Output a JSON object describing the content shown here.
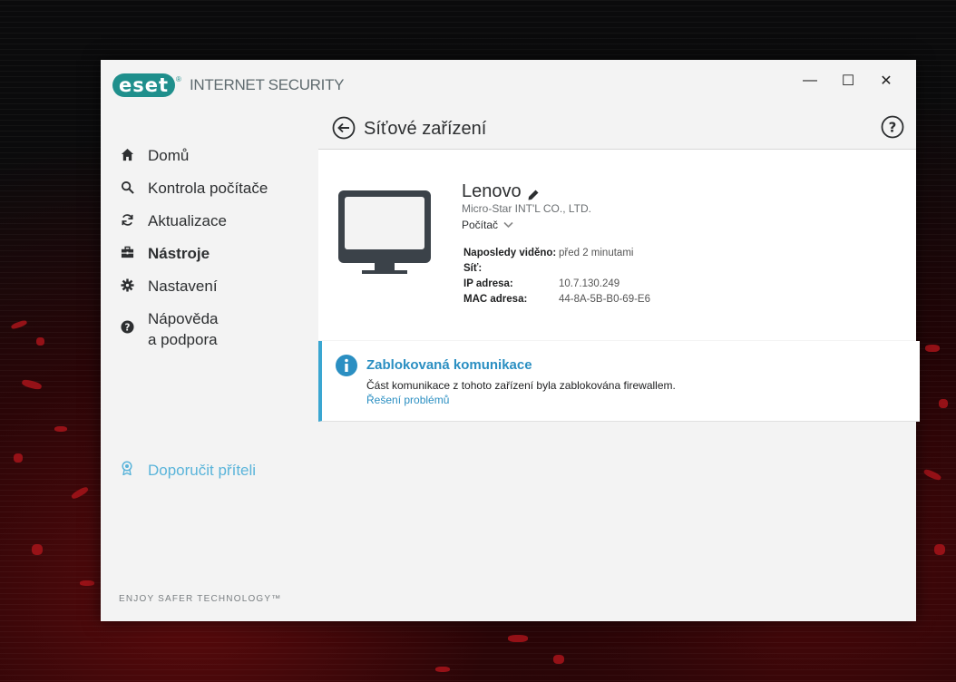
{
  "app": {
    "logo_text": "eset",
    "logo_reg": "®",
    "product_name": "INTERNET SECURITY",
    "accent_color": "#1f8f8c"
  },
  "window_controls": {
    "minimize": "—",
    "maximize": "☐",
    "close": "✕"
  },
  "nav": {
    "items": [
      {
        "label": "Domů",
        "icon": "home-icon"
      },
      {
        "label": "Kontrola počítače",
        "icon": "search-icon"
      },
      {
        "label": "Aktualizace",
        "icon": "refresh-icon"
      },
      {
        "label": "Nástroje",
        "icon": "toolbox-icon",
        "active": true
      },
      {
        "label": "Nastavení",
        "icon": "gear-icon"
      },
      {
        "label_line1": "Nápověda",
        "label_line2": "a podpora",
        "icon": "help-circle-icon"
      }
    ],
    "recommend": "Doporučit příteli",
    "tagline": "ENJOY SAFER TECHNOLOGY™"
  },
  "page": {
    "title": "Síťové zařízení"
  },
  "device": {
    "name": "Lenovo",
    "vendor": "Micro-Star INT'L CO., LTD.",
    "type": "Počítač",
    "properties": [
      {
        "key": "Naposledy viděno:",
        "value": "před 2 minutami"
      },
      {
        "key": "Síť:",
        "value": ""
      },
      {
        "key": "IP adresa:",
        "value": "10.7.130.249"
      },
      {
        "key": "MAC adresa:",
        "value": "44-8A-5B-B0-69-E6"
      }
    ]
  },
  "alert": {
    "title": "Zablokovaná komunikace",
    "description": "Část komunikace z tohoto zařízení byla zablokována firewallem.",
    "link": "Řešení problémů",
    "color": "#3aa6d1"
  }
}
